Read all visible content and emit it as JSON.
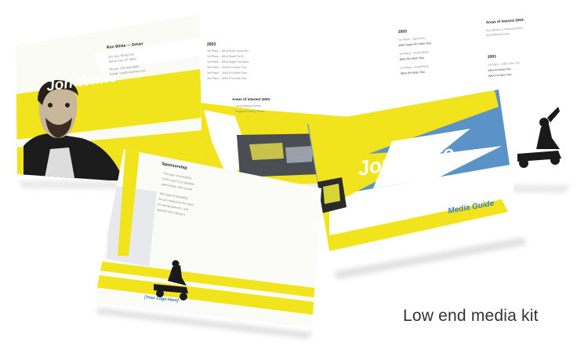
{
  "brochure_name": "Jon White",
  "brochure_alt_name": "Ron White",
  "contact": {
    "heading": "Ron White — Driver",
    "lines": [
      "101 Any Street Rd",
      "Some City, ST 0000",
      "Phone: 000.000.0000",
      "Email: ron@ronwhite.com"
    ]
  },
  "results_2003": {
    "heading": "2003",
    "lines": [
      "1st Place – WKA Road Sprint Pro",
      "1st Place – WKA Road Pro B",
      "1st Place – WKA Super Pro Race",
      "3rd Place – WKA Pro Moto Tour",
      "3rd Place – WKA Pro Moto Tour",
      "3rd Place – WKA Pro Moto Tour"
    ]
  },
  "areas_interest_2003": {
    "heading": "Areas of interest 2003:",
    "lines": [
      "Local Karting Events",
      "Regional Racing Series"
    ]
  },
  "results_2002": {
    "heading": "2002",
    "lines": [
      "1st Place – Sprint Pro",
      "WKA Super Pro Moto Tour",
      "1st Place – Road Sprint",
      "WKA Pro Moto Tour",
      "1st Place – Road Race",
      "WKA Pro Moto Tour"
    ]
  },
  "areas_interest_2004": {
    "heading": "Areas of interest 2004:",
    "lines": [
      "Ron White is a motivated driver",
      "and dedicated racer"
    ]
  },
  "results_2001": {
    "heading": "2001",
    "lines": [
      "1st Place – WKA 125cc Pro",
      "WKA Pro Moto Tour",
      "WKA Pro Moto Tour"
    ]
  },
  "sponsorship": {
    "heading": "Sponsorship",
    "lines": [
      "This type of providing",
      "to the racer is a valuable",
      "partnership, with results",
      "Also type of providing",
      "as you request to the racer,",
      "for racing partners, and",
      "sponsor who racing is"
    ]
  },
  "media_guide_label": "Media Guide",
  "logo_placeholder": "[Your Logo Here]",
  "caption": "Low end media kit",
  "colors": {
    "yellow": "#F2E41C",
    "blue_panel": "#5B93C8",
    "paper": "#FFFFFF",
    "caption_text": "#333333"
  }
}
